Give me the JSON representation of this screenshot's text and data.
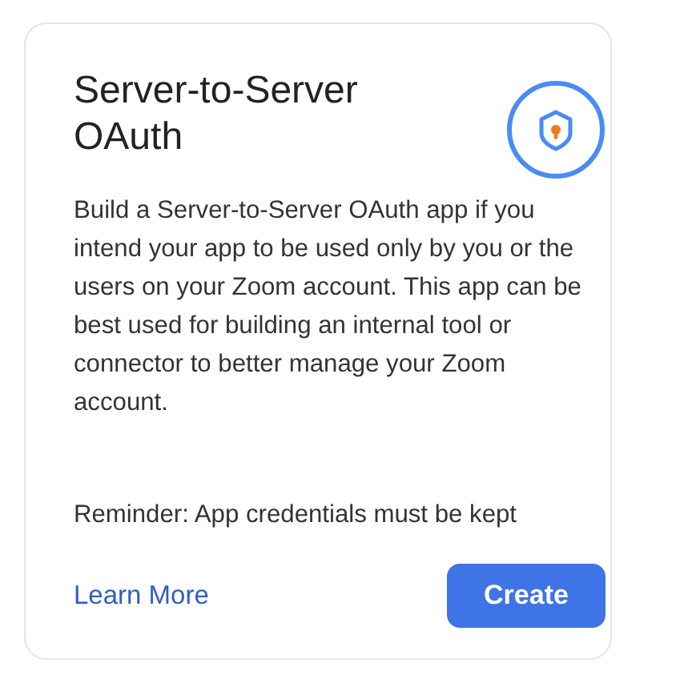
{
  "card": {
    "title": "Server-to-Server OAuth",
    "description": "Build a Server-to-Server OAuth app if you intend your app to be used only by you or the users on your Zoom account. This app can be best used for building an internal tool or connector to better manage your Zoom account.",
    "reminder": "Reminder: App credentials must be kept",
    "link": "Learn More",
    "button": "Create"
  }
}
